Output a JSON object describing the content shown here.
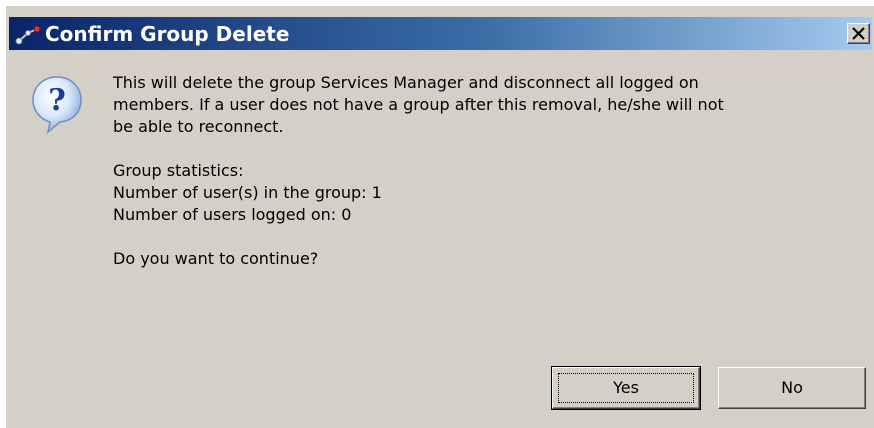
{
  "window": {
    "title": "Confirm Group Delete",
    "close_label": "×"
  },
  "icons": {
    "title": "network-group-icon",
    "question": "question-balloon-icon",
    "close": "close-icon"
  },
  "message": {
    "line1": "This will delete the group Services Manager and disconnect all logged on",
    "line2": "members. If a user does not have a group after this removal, he/she will not",
    "line3": "be able to reconnect.",
    "stats_heading": "Group statistics:",
    "users_in_group": "Number of user(s) in the group: 1",
    "users_logged_on": "Number of users logged on: 0",
    "question": "Do you want to continue?"
  },
  "buttons": {
    "yes_label": "Yes",
    "no_label": "No"
  },
  "colors": {
    "dialog_background": "#d4d0c8",
    "titlebar_start": "#0a246a",
    "titlebar_end": "#a6caf0",
    "title_text": "#ffffff"
  }
}
